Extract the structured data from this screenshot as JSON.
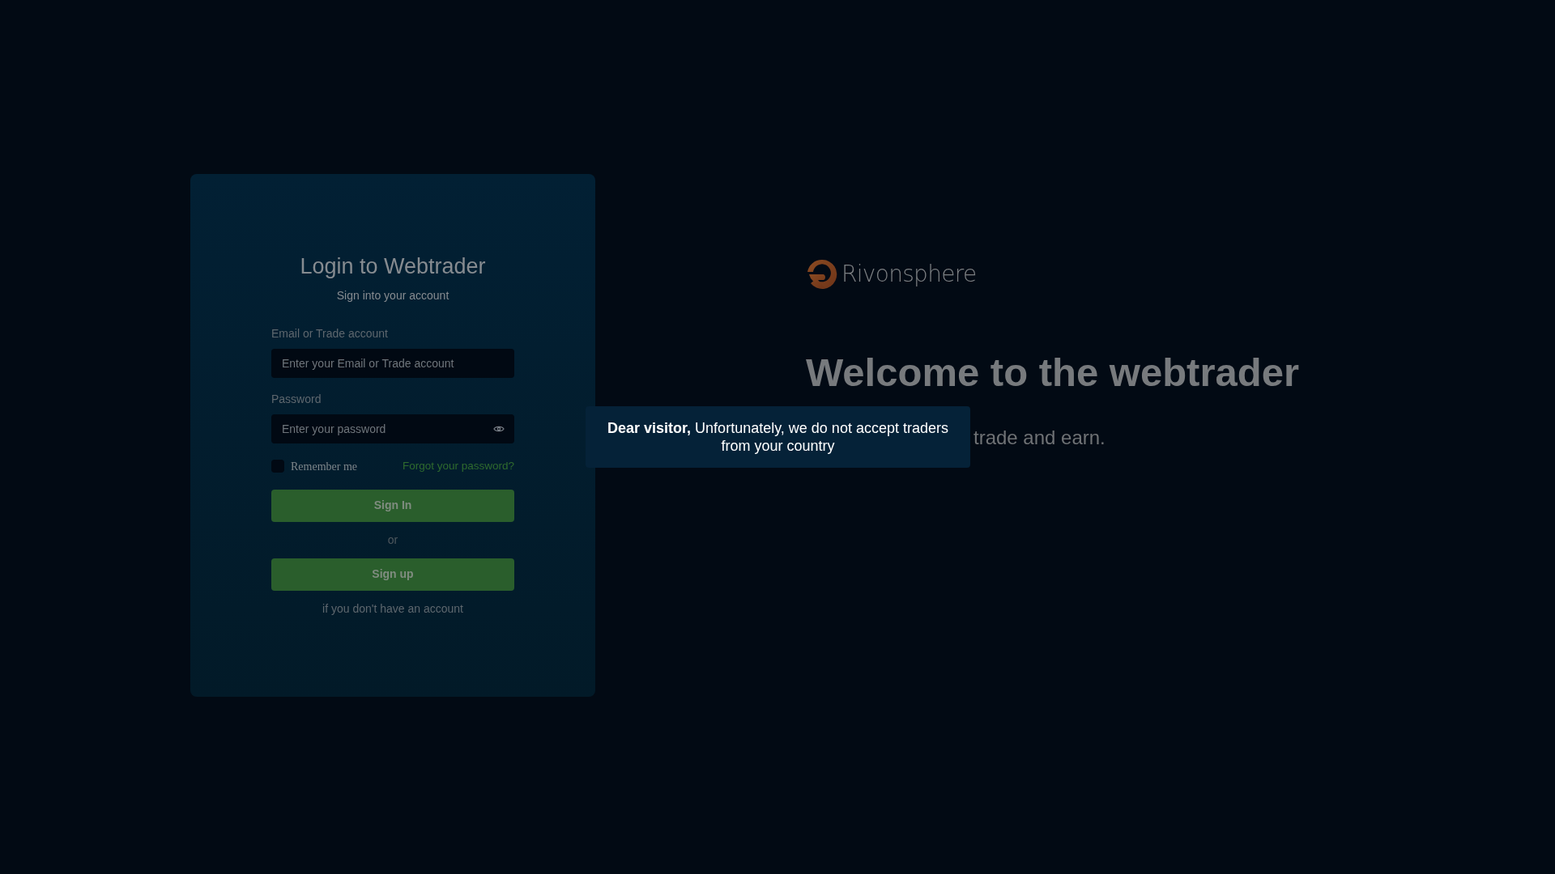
{
  "login": {
    "title": "Login to Webtrader",
    "subtitle": "Sign into your account",
    "fields": [
      {
        "label": "Email or Trade account",
        "placeholder": "Enter your Email or Trade account",
        "kind": "text"
      },
      {
        "label": "Password",
        "placeholder": "Enter your password",
        "kind": "password"
      }
    ],
    "remember": {
      "label": "Remember me",
      "checked": false
    },
    "forgot_link": "Forgot your password?",
    "sign_in_button": "Sign In",
    "separator": "or",
    "sign_up_button": "Sign up",
    "sign_up_hint": "if you don't have an account"
  },
  "brand": {
    "name": "Rivonsphere"
  },
  "hero": {
    "heading": "Welcome to the webtrader",
    "subheading_visible": "trade and earn."
  },
  "notice": {
    "text": "**Dear visitor,** Unfortunately, we do not accept traders from your country"
  }
}
